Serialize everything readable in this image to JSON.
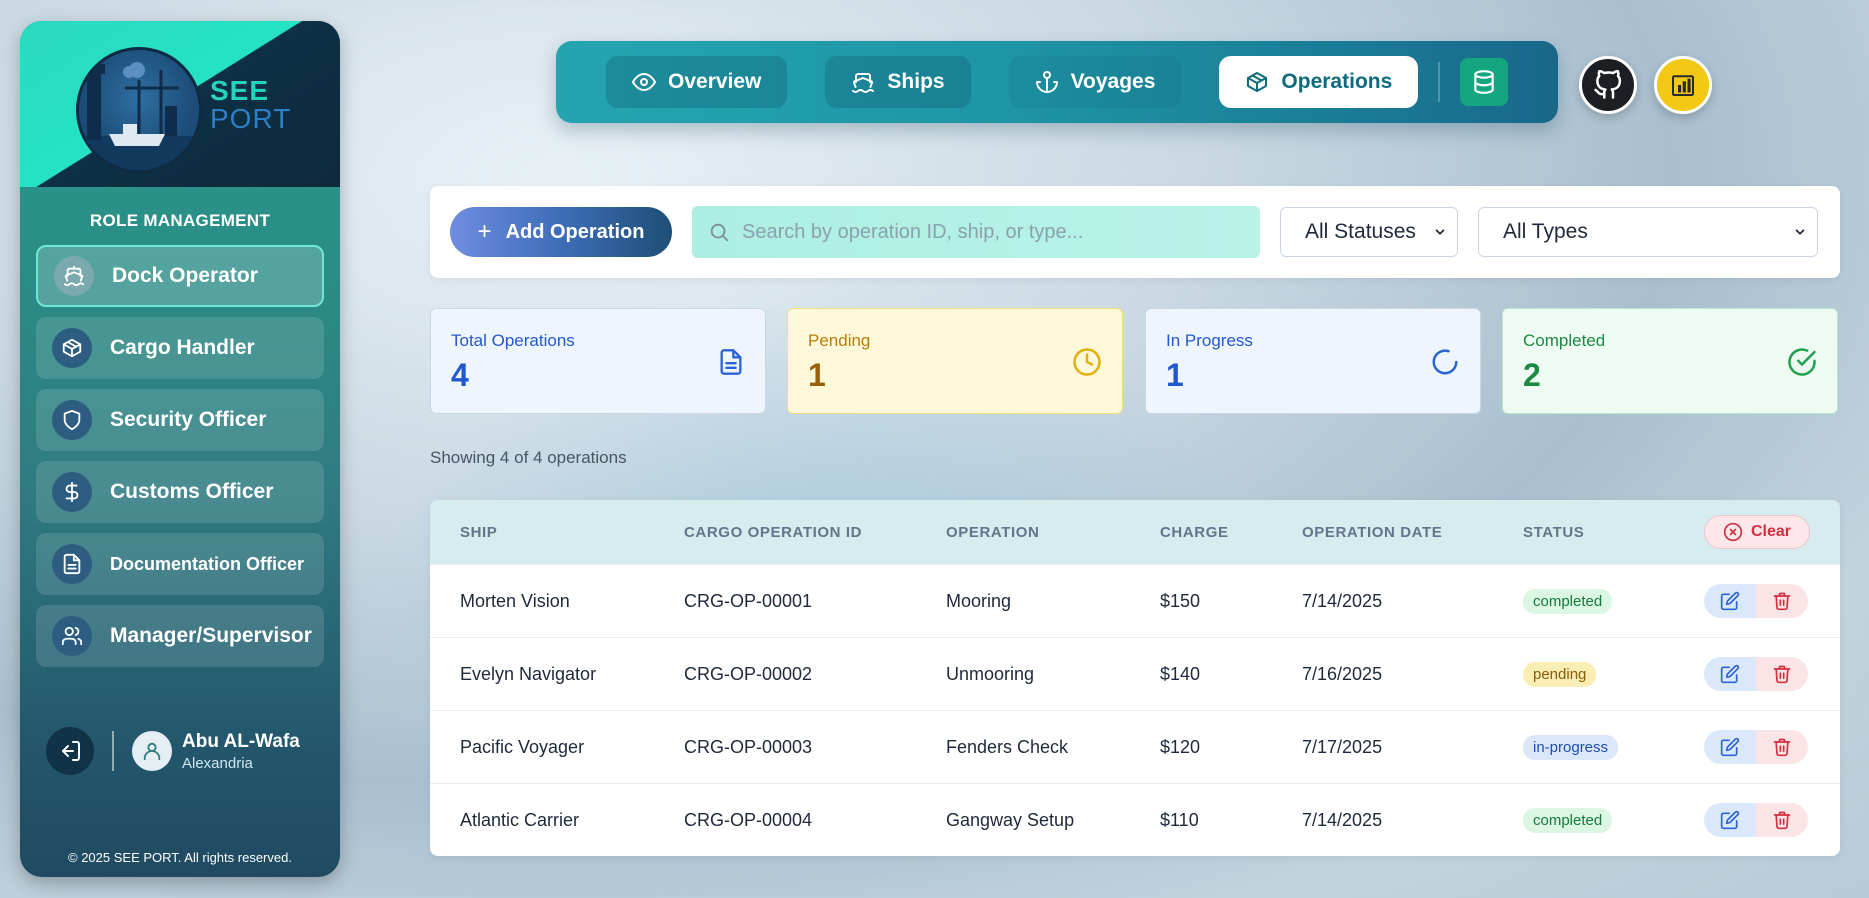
{
  "app": {
    "logo": {
      "line1": "SEE",
      "line2": "PORT"
    },
    "copyright": "© 2025 SEE PORT. All rights reserved."
  },
  "sidebar": {
    "section_title": "ROLE MANAGEMENT",
    "roles": [
      {
        "label": "Dock Operator",
        "icon": "ship-icon",
        "active": true
      },
      {
        "label": "Cargo Handler",
        "icon": "box-icon"
      },
      {
        "label": "Security Officer",
        "icon": "shield-icon"
      },
      {
        "label": "Customs Officer",
        "icon": "dollar-icon"
      },
      {
        "label": "Documentation Officer",
        "icon": "document-icon"
      },
      {
        "label": "Manager/Supervisor",
        "icon": "users-icon"
      }
    ],
    "user": {
      "name": "Abu AL-Wafa",
      "city": "Alexandria"
    }
  },
  "nav": {
    "tabs": [
      {
        "label": "Overview",
        "icon": "eye-icon"
      },
      {
        "label": "Ships",
        "icon": "ship-icon"
      },
      {
        "label": "Voyages",
        "icon": "anchor-icon"
      },
      {
        "label": "Operations",
        "icon": "box-icon",
        "active": true
      }
    ],
    "extra_buttons": [
      "database-icon",
      "github-icon",
      "powerbi-icon"
    ]
  },
  "toolbar": {
    "add_label": "Add Operation",
    "search_placeholder": "Search by operation ID, ship, or type...",
    "status_filter": "All Statuses",
    "type_filter": "All Types"
  },
  "stats": {
    "total": {
      "label": "Total Operations",
      "value": "4"
    },
    "pending": {
      "label": "Pending",
      "value": "1"
    },
    "in_progress": {
      "label": "In Progress",
      "value": "1"
    },
    "completed": {
      "label": "Completed",
      "value": "2"
    }
  },
  "showing_text": "Showing 4 of 4 operations",
  "table": {
    "headers": {
      "ship": "SHIP",
      "cargo_id": "CARGO OPERATION ID",
      "operation": "OPERATION",
      "charge": "CHARGE",
      "date": "OPERATION DATE",
      "status": "STATUS",
      "clear": "Clear"
    },
    "rows": [
      {
        "ship": "Morten Vision",
        "cargo_id": "CRG-OP-00001",
        "operation": "Mooring",
        "charge": "$150",
        "date": "7/14/2025",
        "status": "completed"
      },
      {
        "ship": "Evelyn Navigator",
        "cargo_id": "CRG-OP-00002",
        "operation": "Unmooring",
        "charge": "$140",
        "date": "7/16/2025",
        "status": "pending"
      },
      {
        "ship": "Pacific Voyager",
        "cargo_id": "CRG-OP-00003",
        "operation": "Fenders Check",
        "charge": "$120",
        "date": "7/17/2025",
        "status": "in-progress"
      },
      {
        "ship": "Atlantic Carrier",
        "cargo_id": "CRG-OP-00004",
        "operation": "Gangway Setup",
        "charge": "$110",
        "date": "7/14/2025",
        "status": "completed"
      }
    ]
  },
  "colors": {
    "accent_teal": "#25a4b0",
    "completed": "#1d8a44",
    "pending": "#b97e05",
    "in_progress": "#2258cf",
    "danger": "#d3303f"
  }
}
